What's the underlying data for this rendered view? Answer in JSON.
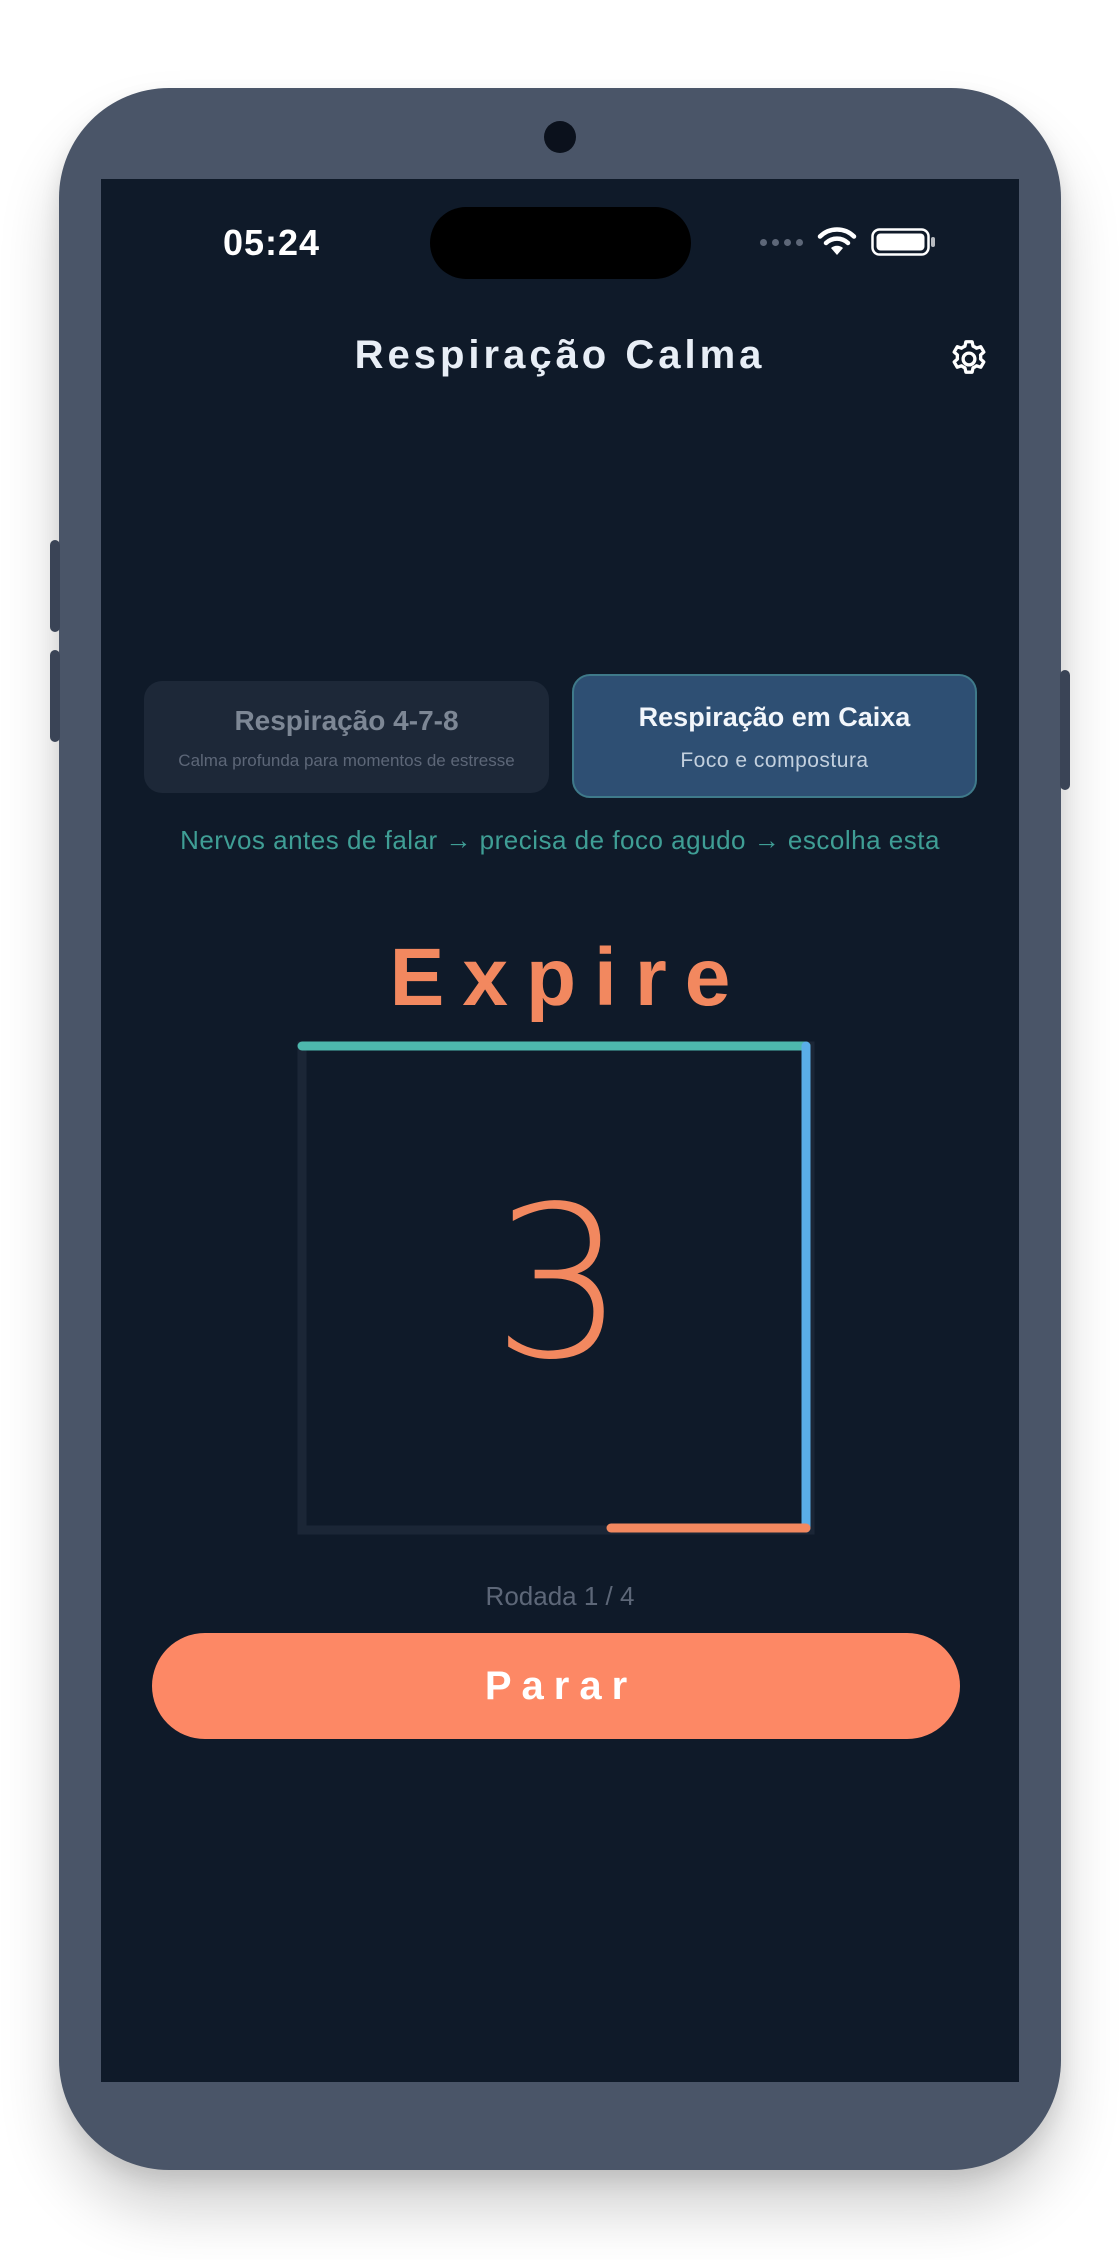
{
  "status_bar": {
    "time": "05:24"
  },
  "header": {
    "title": "Respiração Calma",
    "settings_icon": "gear-icon"
  },
  "techniques": [
    {
      "title": "Respiração 4-7-8",
      "subtitle": "Calma profunda para momentos de estresse",
      "selected": false
    },
    {
      "title": "Respiração em Caixa",
      "subtitle": "Foco e compostura",
      "selected": true
    }
  ],
  "hint": "Nervos antes de falar → precisa de foco agudo → escolha esta",
  "exercise": {
    "phase": "Expire",
    "count": "3",
    "round_label": "Rodada 1 / 4",
    "box_progress": 0.69
  },
  "actions": {
    "stop_label": "Parar"
  },
  "colors": {
    "background": "#0f1a29",
    "accent": "#fd8865",
    "teal": "#4db8ad",
    "blue": "#5aaee8"
  }
}
